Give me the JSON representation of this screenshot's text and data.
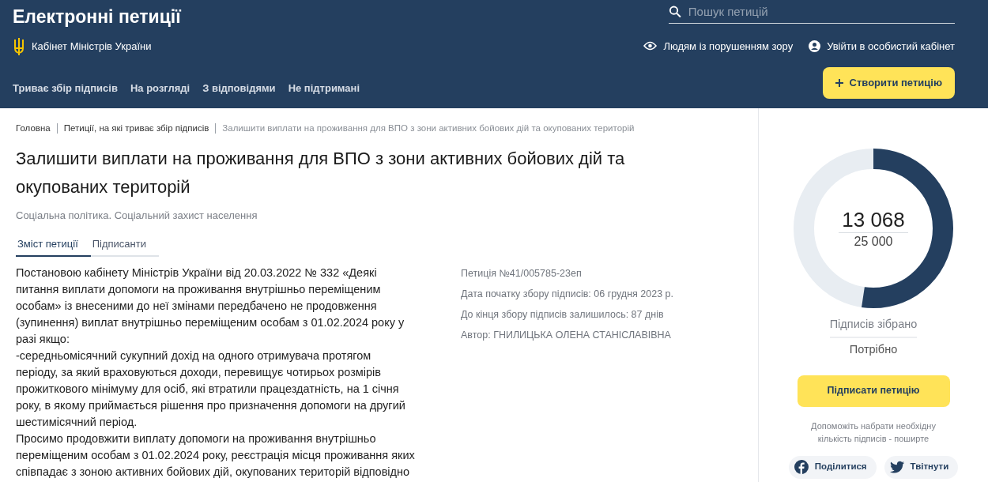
{
  "header": {
    "title": "Електронні петиції",
    "subtitle": "Кабінет Міністрів України",
    "search": {
      "placeholder": "Пошук петицій"
    },
    "links": [
      "Людям із порушенням зору",
      "Увійти в особистий кабінет"
    ],
    "nav": [
      {
        "label": "Триває збір підписів"
      },
      {
        "label": "На розгляді"
      },
      {
        "label": "З відповідями"
      },
      {
        "label": "Не підтримані"
      }
    ],
    "create_button": "Створити петицію"
  },
  "breadcrumbs": [
    {
      "label": "Головна"
    },
    {
      "label": "Петиції, на які триває збір підписів"
    },
    {
      "label": "Залишити виплати на проживання для ВПО з зони активних бойових дій та окупованих територій"
    }
  ],
  "petition": {
    "title": "Залишити виплати на проживання для ВПО з зони активних бойових дій та окупованих територій",
    "category": "Соціальна політика. Соціальний захист населення",
    "tabs": [
      {
        "label": "Зміст петиції",
        "selected": true
      },
      {
        "label": "Підписанти",
        "selected": false
      }
    ],
    "body": [
      "Постановою кабінету Міністрів України від 20.03.2022 № 332   «Деякі питання виплати допомоги на проживання внутрішньо переміщеним особам» із внесеними до неї змінами передбачено не продовження (зупинення) виплат внутрішньо переміщеним особам з 01.02.2024 року у разі якщо:",
      "-середньомісячний сукупний дохід на одного отримувача протягом періоду, за який враховуються доходи, перевищує чотирьох розмірів прожиткового мінімуму для осіб, які втратили працездатність, на 1 січня року, в якому приймається рішення про призначення допомоги на другий шестимісячний період.",
      "Просимо продовжити виплату допомоги на проживання внутрішньо переміщеним особам з 01.02.2024 року, реєстрація місця проживання яких співпадає з зоною активних бойових дій, окупованих територій відповідно"
    ],
    "meta": [
      "Петиція №41/005785-23еп",
      "Дата початку збору підписів: 06 грудня 2023 р.",
      "До кінця збору підписів залишилось: 87 днів",
      "Автор: ГНИЛИЦЬКА ОЛЕНА СТАНІСЛАВІВНА"
    ]
  },
  "signatures": {
    "collected": "13 068",
    "required": "25 000",
    "level": 0.523,
    "collected_label": "Підписів зібрано",
    "required_label": "Потрібно",
    "sign_button": "Підписати петицію",
    "hint": "Допоможіть набрати необхідну кількість підписів - поширте",
    "share": [
      {
        "kind": "facebook",
        "label": "Поділитися"
      },
      {
        "kind": "twitter",
        "label": "Твітнути"
      }
    ]
  }
}
